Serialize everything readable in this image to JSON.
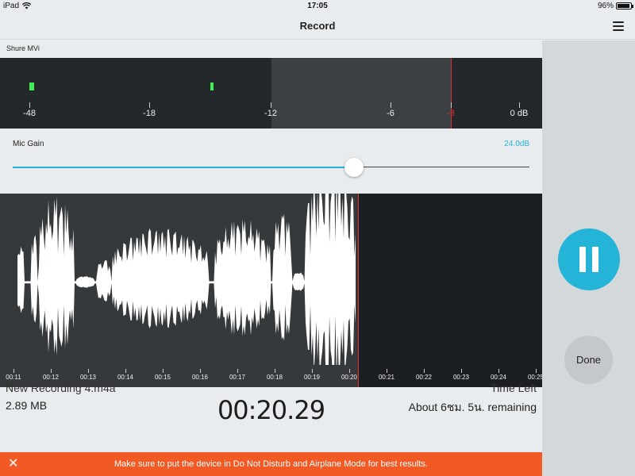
{
  "status_bar": {
    "carrier": "iPad",
    "time": "17:05",
    "battery": "96%",
    "battery_level": 0.96
  },
  "nav": {
    "title": "Record"
  },
  "input_device": "Shure MVi",
  "meter": {
    "labels": [
      "-48",
      "-18",
      "-12",
      "-6",
      "-3",
      "0 dB"
    ],
    "peak_label": "-3"
  },
  "gain": {
    "label": "Mic Gain",
    "value": "24.0dB",
    "level": 0.66
  },
  "waveform": {
    "time_labels": [
      "00:11",
      "00:12",
      "00:13",
      "00:14",
      "00:15",
      "00:16",
      "00:17",
      "00:18",
      "00:19",
      "00:20",
      "00:21",
      "00:22",
      "00:23",
      "00:24",
      "00:25"
    ]
  },
  "recording": {
    "name": "New Recording 4.m4a",
    "time_left_label": "Time Left",
    "file_size": "2.89 MB",
    "elapsed": "00:20.29",
    "remaining": "About 6ชม. 5น. remaining"
  },
  "banner": {
    "close": "✕",
    "text": "Make sure to put the device in Do Not Disturb and Airplane Mode for best results."
  },
  "controls": {
    "done": "Done"
  },
  "colors": {
    "accent": "#23b4d8",
    "banner": "#f15a24",
    "peak": "#d63232",
    "led": "#3df04f"
  }
}
